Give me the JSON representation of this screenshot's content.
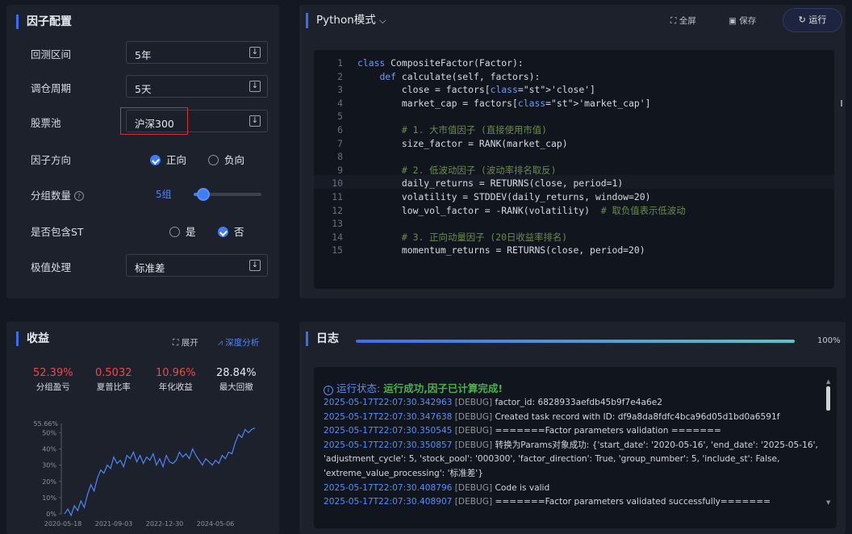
{
  "factor_config": {
    "title": "因子配置",
    "backtest_label": "回测区间",
    "backtest_value": "5年",
    "rebalance_label": "调仓周期",
    "rebalance_value": "5天",
    "pool_label": "股票池",
    "pool_value": "沪深300",
    "direction_label": "因子方向",
    "direction_pos": "正向",
    "direction_neg": "负向",
    "groups_label": "分组数量",
    "groups_value": "5组",
    "st_label": "是否包含ST",
    "st_yes": "是",
    "st_no": "否",
    "extreme_label": "极值处理",
    "extreme_value": "标准差",
    "dropdown_icon": "chevron-down-box-icon"
  },
  "editor": {
    "mode_label": "Python模式",
    "fullscreen_label": "全屏",
    "save_label": "保存",
    "run_label": "运行",
    "lines": [
      {
        "n": "1",
        "code": "class CompositeFactor(Factor):"
      },
      {
        "n": "2",
        "code": "    def calculate(self, factors):"
      },
      {
        "n": "3",
        "code": "        close = factors['close']"
      },
      {
        "n": "4",
        "code": "        market_cap = factors['market_cap']"
      },
      {
        "n": "5",
        "code": ""
      },
      {
        "n": "6",
        "code": "        # 1. 大市值因子 (直接使用市值)"
      },
      {
        "n": "7",
        "code": "        size_factor = RANK(market_cap)"
      },
      {
        "n": "8",
        "code": ""
      },
      {
        "n": "9",
        "code": "        # 2. 低波动因子 (波动率排名取反)"
      },
      {
        "n": "10",
        "code": "        daily_returns = RETURNS(close, period=1)"
      },
      {
        "n": "11",
        "code": "        volatility = STDDEV(daily_returns, window=20)"
      },
      {
        "n": "12",
        "code": "        low_vol_factor = -RANK(volatility)  # 取负值表示低波动"
      },
      {
        "n": "13",
        "code": ""
      },
      {
        "n": "14",
        "code": "        # 3. 正向动量因子 (20日收益率排名)"
      },
      {
        "n": "15",
        "code": "        momentum_returns = RETURNS(close, period=20)"
      }
    ]
  },
  "returns": {
    "title": "收益",
    "expand_label": "展开",
    "analysis_label": "深度分析",
    "stats": [
      {
        "value": "52.39%",
        "label": "分组盈亏",
        "color": "#e84c4c"
      },
      {
        "value": "0.5032",
        "label": "夏普比率",
        "color": "#e84c4c"
      },
      {
        "value": "10.96%",
        "label": "年化收益",
        "color": "#e84c4c"
      },
      {
        "value": "28.84%",
        "label": "最大回撤",
        "color": "#e6eaf0"
      }
    ]
  },
  "chart_data": {
    "type": "line",
    "title": "",
    "xlabel": "",
    "ylabel": "",
    "x_ticks": [
      "2020-05-18",
      "2021-09-03",
      "2022-12-30",
      "2024-05-06"
    ],
    "y_ticks": [
      "0%",
      "10%",
      "20%",
      "30%",
      "40%",
      "50%"
    ],
    "y_max_label": "55.66%",
    "ylim": [
      0,
      55.66
    ],
    "line_color": "#4f86f7",
    "series": [
      {
        "values": [
          0,
          3,
          -1,
          5,
          2,
          8,
          4,
          12,
          18,
          14,
          22,
          27,
          25,
          30,
          28,
          35,
          31,
          33,
          29,
          36,
          34,
          38,
          32,
          36,
          31,
          35,
          33,
          37,
          30,
          34,
          29,
          36,
          32,
          31,
          33,
          38,
          35,
          37,
          34,
          40,
          36,
          33,
          30,
          34,
          32,
          30,
          33,
          31,
          36,
          34,
          38,
          37,
          44,
          49,
          47,
          52,
          50,
          52,
          53
        ]
      }
    ]
  },
  "log": {
    "title": "日志",
    "progress_label": "100%",
    "progress": 1.0,
    "status_label": "运行状态:",
    "status_text": "运行成功,因子已计算完成!",
    "lines": [
      {
        "ts": "2025-05-17T22:07:30.342963",
        "lvl": "[DEBUG]",
        "msg": "factor_id: 6828933aefdb45b9f7e4a6e2"
      },
      {
        "ts": "2025-05-17T22:07:30.347638",
        "lvl": "[DEBUG]",
        "msg": "Created task record with ID: df9a8da8fdfc4bca96d05d1bd0a6591f"
      },
      {
        "ts": "2025-05-17T22:07:30.350545",
        "lvl": "[DEBUG]",
        "msg": "=======Factor parameters validation ======="
      },
      {
        "ts": "2025-05-17T22:07:30.350857",
        "lvl": "[DEBUG]",
        "msg": "转换为Params对象成功: {'start_date': '2020-05-16', 'end_date': '2025-05-16',"
      },
      {
        "ts": "",
        "lvl": "",
        "msg": "'adjustment_cycle': 5, 'stock_pool': '000300', 'factor_direction': True, 'group_number': 5, 'include_st': False,"
      },
      {
        "ts": "",
        "lvl": "",
        "msg": "'extreme_value_processing': '标准差'}"
      },
      {
        "ts": "2025-05-17T22:07:30.408796",
        "lvl": "[DEBUG]",
        "msg": "Code is valid"
      },
      {
        "ts": "2025-05-17T22:07:30.408907",
        "lvl": "[DEBUG]",
        "msg": "=======Factor parameters validated successfully======="
      }
    ]
  }
}
